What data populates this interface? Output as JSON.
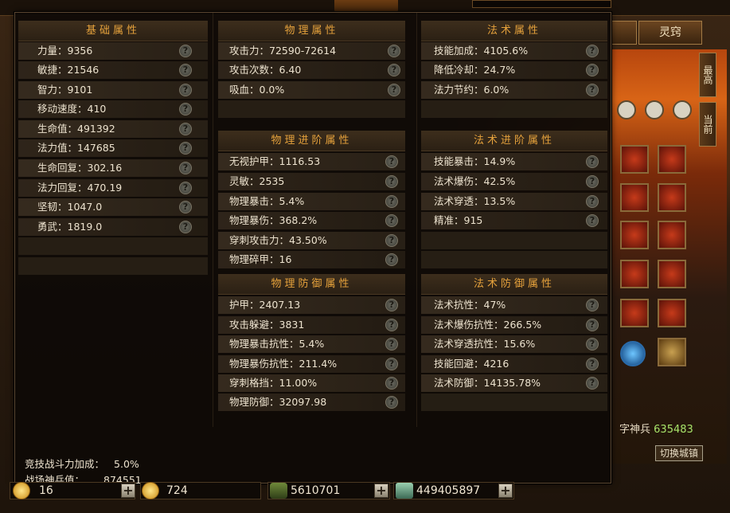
{
  "background": {
    "tab_label": "灵窍",
    "vertical_tabs": [
      "最高",
      "当前"
    ],
    "shenbing_label": "字神兵",
    "shenbing_value": "635483",
    "switch_button": "切换城镇"
  },
  "columns": [
    {
      "sections": [
        {
          "title": "基础属性",
          "rows": [
            "力量：9356",
            "敏捷：21546",
            "智力：9101",
            "移动速度：410",
            "生命值：491392",
            "法力值：147685",
            "生命回复：302.16",
            "法力回复：470.19",
            "坚韧：1047.0",
            "勇武：1819.0"
          ]
        }
      ]
    },
    {
      "sections": [
        {
          "title": "物理属性",
          "rows": [
            "攻击力：72590-72614",
            "攻击次数：6.40",
            "吸血：0.0%"
          ]
        },
        {
          "title": "物理进阶属性",
          "rows": [
            "无视护甲：1116.53",
            "灵敏：2535",
            "物理暴击：5.4%",
            "物理暴伤：368.2%",
            "穿刺攻击力：43.50%",
            "物理碎甲：16"
          ]
        },
        {
          "title": "物理防御属性",
          "rows": [
            "护甲：2407.13",
            "攻击躲避：3831",
            "物理暴击抗性：5.4%",
            "物理暴伤抗性：211.4%",
            "穿刺格挡：11.00%",
            "物理防御：32097.98"
          ]
        }
      ]
    },
    {
      "sections": [
        {
          "title": "法术属性",
          "rows": [
            "技能加成：4105.6%",
            "降低冷却：24.7%",
            "法力节约：6.0%"
          ]
        },
        {
          "title": "法术进阶属性",
          "rows": [
            "技能暴击：14.9%",
            "法术爆伤：42.5%",
            "法术穿透：13.5%",
            "精准：915"
          ]
        },
        {
          "title": "法术防御属性",
          "rows": [
            "法术抗性：47%",
            "法术爆伤抗性：266.5%",
            "法术穿透抗性：15.6%",
            "技能回避：4216",
            "法术防御：14135.78%"
          ]
        }
      ]
    }
  ],
  "footer": {
    "arena_label": "竞技战斗力加成：",
    "arena_value": "5.0%",
    "shenbing_label": "战场神兵值：",
    "shenbing_value": "874551"
  },
  "resources": {
    "gold_ingot": "16",
    "bound_gold": "724",
    "dragon_currency": "5610701",
    "money": "449405897"
  }
}
